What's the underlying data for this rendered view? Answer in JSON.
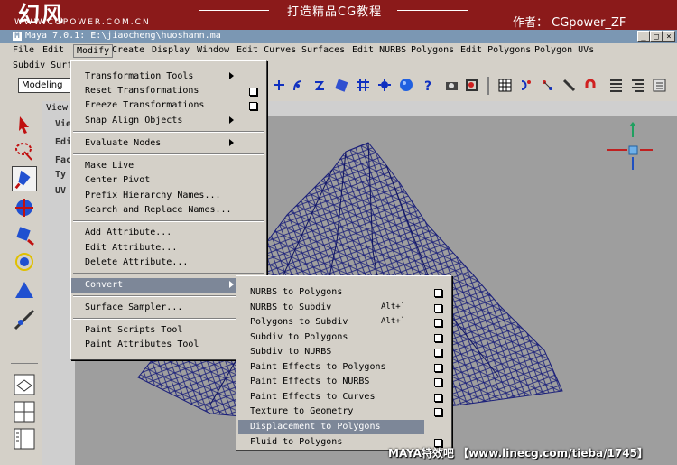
{
  "banner": {
    "logo_text": "幻风",
    "logo_url": "WWW.CGPOWER.COM.CN",
    "title": "打造精品CG教程",
    "author": "作者： CGpower_ZF"
  },
  "window": {
    "title": "Maya 7.0.1: E:\\jiaocheng\\huoshann.ma",
    "minimize": "_",
    "maximize": "□",
    "close": "×"
  },
  "menubar": {
    "row1": [
      "File",
      "Edit",
      "Modify",
      "Create",
      "Display",
      "Window",
      "Edit Curves",
      "Surfaces",
      "Edit NURBS",
      "Polygons",
      "Edit Polygons",
      "Polygon UVs"
    ],
    "row2": [
      "Subdiv Surf"
    ]
  },
  "shelf": {
    "mode": "Modeling"
  },
  "viewport": {
    "tab": "View",
    "side_labels": [
      "Vie",
      "Edi",
      "Fac",
      "Ty",
      "UV"
    ]
  },
  "modify_menu": {
    "items": [
      {
        "label": "Transformation Tools"
      },
      {
        "label": "Reset Transformations"
      },
      {
        "label": "Freeze Transformations"
      },
      {
        "label": "Snap Align Objects"
      },
      {
        "label": "Evaluate Nodes"
      },
      {
        "label": "Make Live"
      },
      {
        "label": "Center Pivot"
      },
      {
        "label": "Prefix Hierarchy Names..."
      },
      {
        "label": "Search and Replace Names..."
      },
      {
        "label": "Add Attribute..."
      },
      {
        "label": "Edit Attribute..."
      },
      {
        "label": "Delete Attribute..."
      },
      {
        "label": "Convert"
      },
      {
        "label": "Surface Sampler..."
      },
      {
        "label": "Paint Scripts Tool"
      },
      {
        "label": "Paint Attributes Tool"
      }
    ]
  },
  "convert_menu": {
    "items": [
      {
        "label": "NURBS to Polygons",
        "shortcut": ""
      },
      {
        "label": "NURBS to Subdiv",
        "shortcut": "Alt+`"
      },
      {
        "label": "Polygons to Subdiv",
        "shortcut": "Alt+`"
      },
      {
        "label": "Subdiv to Polygons",
        "shortcut": ""
      },
      {
        "label": "Subdiv to NURBS",
        "shortcut": ""
      },
      {
        "label": "Paint Effects to Polygons",
        "shortcut": ""
      },
      {
        "label": "Paint Effects to NURBS",
        "shortcut": ""
      },
      {
        "label": "Paint Effects to Curves",
        "shortcut": ""
      },
      {
        "label": "Texture to Geometry",
        "shortcut": ""
      },
      {
        "label": "Displacement to Polygons",
        "shortcut": ""
      },
      {
        "label": "Fluid to Polygons",
        "shortcut": ""
      }
    ]
  },
  "watermark": "MAYA特效吧  【www.linecg.com/tieba/1745】",
  "colors": {
    "banner": "#8b1a1a",
    "titlebar": "#7b97b3",
    "highlight": "#7d8798",
    "wireframe": "#1a1f7a",
    "viewport": "#9e9e9e"
  }
}
